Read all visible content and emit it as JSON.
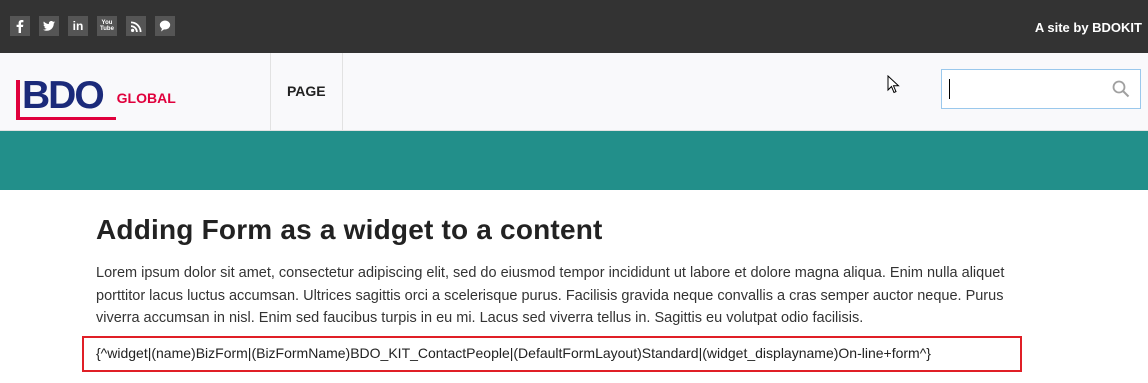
{
  "topbar": {
    "social": [
      {
        "name": "facebook-icon",
        "glyph": "f"
      },
      {
        "name": "twitter-icon",
        "glyph": "🐦"
      },
      {
        "name": "linkedin-icon",
        "glyph": "in"
      },
      {
        "name": "youtube-icon",
        "glyph": "You Tube"
      },
      {
        "name": "rss-icon",
        "glyph": "rss"
      },
      {
        "name": "chat-icon",
        "glyph": "chat"
      }
    ],
    "site_by": "A site by BDOKIT"
  },
  "header": {
    "logo_text": "BDO",
    "logo_sub": "GLOBAL",
    "nav": [
      "PAGE"
    ],
    "search": {
      "value": "",
      "placeholder": ""
    }
  },
  "content": {
    "title": "Adding Form as a widget to a content",
    "paragraph": "Lorem ipsum dolor sit amet, consectetur adipiscing elit, sed do eiusmod tempor incididunt ut labore et dolore magna aliqua. Enim nulla aliquet porttitor lacus luctus accumsan. Ultrices sagittis orci a scelerisque purus. Facilisis gravida neque convallis a cras semper auctor neque. Purus viverra accumsan in nisl. Enim sed faucibus turpis in eu mi. Lacus sed viverra tellus in. Sagittis eu volutpat odio facilisis.",
    "widget_code": "{^widget|(name)BizForm|(BizFormName)BDO_KIT_ContactPeople|(DefaultFormLayout)Standard|(widget_displayname)On-line+form^}"
  },
  "colors": {
    "topbar": "#333333",
    "teal_band": "#228f8a",
    "brand_blue": "#1b2a7a",
    "brand_red": "#e0003c",
    "highlight_border": "#e01f26"
  }
}
